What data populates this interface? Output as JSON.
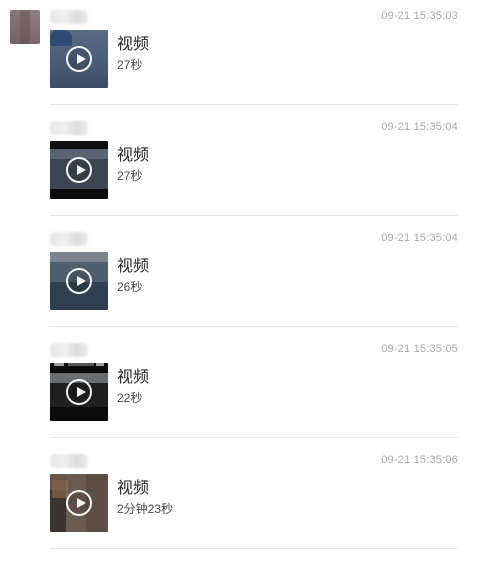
{
  "messages": [
    {
      "timestamp": "09-21 15:35:03",
      "title": "视频",
      "duration": "27秒"
    },
    {
      "timestamp": "09-21 15:35:04",
      "title": "视频",
      "duration": "27秒"
    },
    {
      "timestamp": "09-21 15:35:04",
      "title": "视频",
      "duration": "26秒"
    },
    {
      "timestamp": "09-21 15:35:05",
      "title": "视频",
      "duration": "22秒"
    },
    {
      "timestamp": "09-21 15:35:06",
      "title": "视频",
      "duration": "2分钟23秒"
    }
  ],
  "icons": {
    "play": "play-circle-icon"
  }
}
